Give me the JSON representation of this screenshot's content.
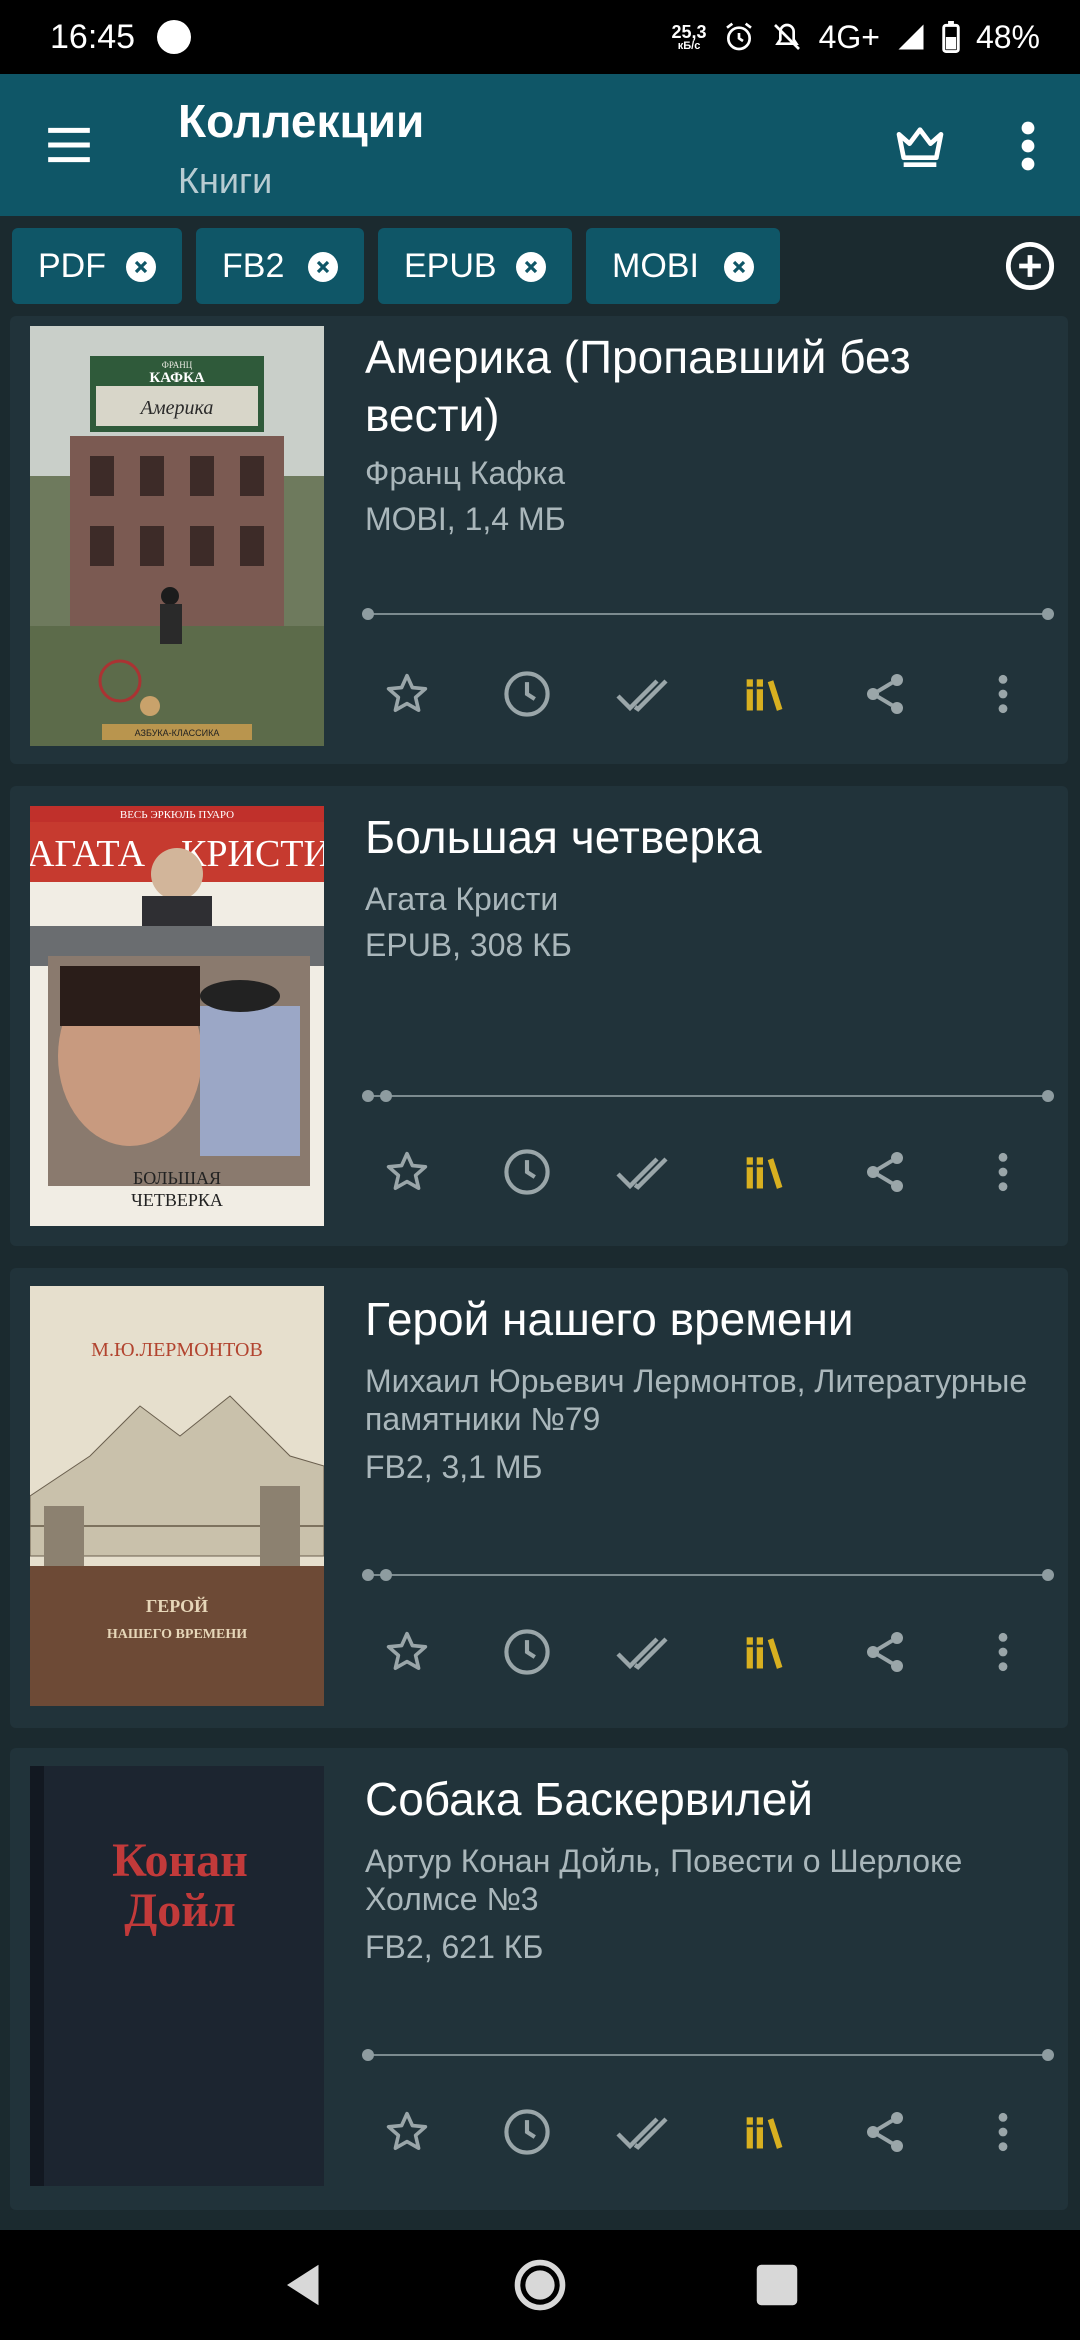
{
  "status_bar": {
    "time": "16:45",
    "net_speed_value": "25,3",
    "net_speed_unit": "кБ/с",
    "network": "4G+",
    "battery": "48%"
  },
  "app_bar": {
    "title": "Коллекции",
    "subtitle": "Книги",
    "icons": [
      "menu-icon",
      "crown-icon",
      "more-vert-icon"
    ]
  },
  "filter_chips": [
    {
      "label": "PDF"
    },
    {
      "label": "FB2"
    },
    {
      "label": "EPUB"
    },
    {
      "label": "MOBI"
    }
  ],
  "books": [
    {
      "title": "Америка (Пропавший без вести)",
      "author": "Франц Кафка",
      "file_info": "MOBI, 1,4 МБ",
      "cover_top_text": "ФРАНЦ",
      "cover_author": "КАФКА",
      "cover_title": "Америка",
      "cover_publisher": "АЗБУКА-КЛАССИКА",
      "progress": 0.0
    },
    {
      "title": "Большая четверка",
      "author": "Агата Кристи",
      "file_info": "EPUB, 308 КБ",
      "cover_series": "ВЕСЬ ЭРКЮЛЬ ПУАРО",
      "cover_author_1": "АГАТА",
      "cover_author_2": "КРИСТИ",
      "cover_title_1": "БОЛЬШАЯ",
      "cover_title_2": "ЧЕТВЕРКА",
      "progress": 0.02
    },
    {
      "title": "Герой нашего времени",
      "author": "Михаил Юрьевич Лермонтов, Литературные памятники №79",
      "file_info": "FB2, 3,1 МБ",
      "cover_author": "М.Ю.ЛЕРМОНТОВ",
      "cover_title_1": "ГЕРОЙ",
      "cover_title_2": "НАШЕГО ВРЕМЕНИ",
      "progress": 0.02
    },
    {
      "title": "Собака Баскервилей",
      "author": "Артур Конан Дойль, Повести о Шерлоке Холмсе №3",
      "file_info": "FB2, 621 КБ",
      "cover_line_1": "Конан",
      "cover_line_2": "Дойл",
      "progress": 0.0
    }
  ],
  "card_actions": [
    "star-icon",
    "history-icon",
    "done-all-icon",
    "library-icon",
    "share-icon",
    "more-vert-icon"
  ],
  "colors": {
    "app_bar": "#0f5667",
    "background": "#1b2a2f",
    "card": "#21333a",
    "library_accent": "#d8b020",
    "icon_grey": "#9aa6a9"
  },
  "nav_bar": [
    "back-icon",
    "home-icon",
    "recents-icon"
  ]
}
